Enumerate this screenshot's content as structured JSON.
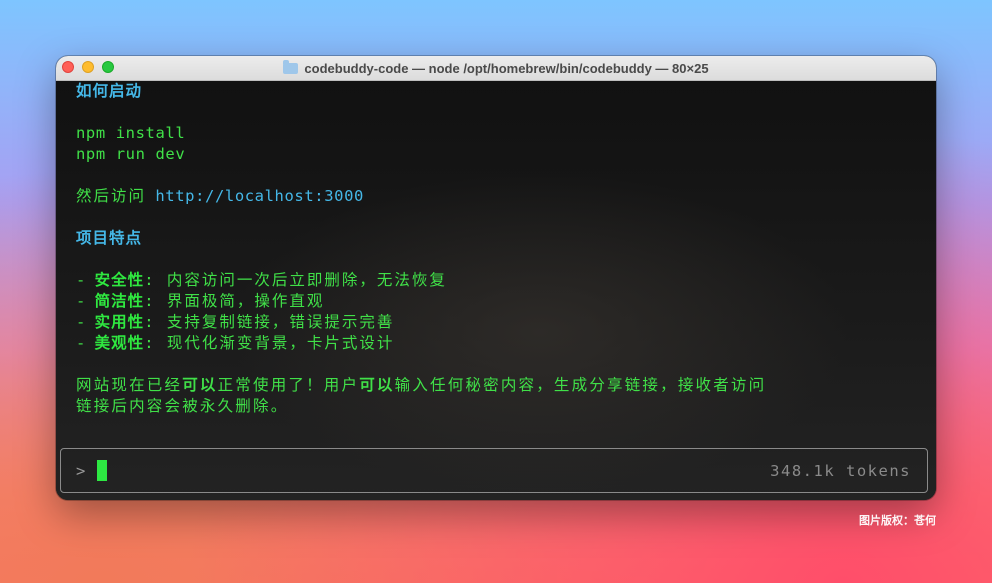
{
  "window": {
    "title": "codebuddy-code — node /opt/homebrew/bin/codebuddy — 80×25",
    "icon": "folder-icon"
  },
  "terminal": {
    "heading_start": "如何启动",
    "cmd_install": "npm install",
    "cmd_run": "npm run dev",
    "visit_prefix": "然后访问",
    "visit_url": "http://localhost:3000",
    "heading_features": "项目特点",
    "features": [
      {
        "dash": "- ",
        "label": "安全性",
        "text": ": 内容访问一次后立即删除，无法恢复"
      },
      {
        "dash": "- ",
        "label": "简洁性",
        "text": ": 界面极简，操作直观"
      },
      {
        "dash": "- ",
        "label": "实用性",
        "text": ": 支持复制链接，错误提示完善"
      },
      {
        "dash": "- ",
        "label": "美观性",
        "text": ": 现代化渐变背景，卡片式设计"
      }
    ],
    "summary_line1_a": "网站现在已经",
    "summary_line1_b": "可以",
    "summary_line1_c": "正常使用了！用户",
    "summary_line1_d": "可以",
    "summary_line1_e": "输入任何秘密内容，生成分享链接，接收者访问",
    "summary_line2": "链接后内容会被永久删除。"
  },
  "input": {
    "prompt": ">",
    "tokens": "348.1k tokens"
  },
  "watermark": "图片版权：苍何",
  "colors": {
    "green": "#40e048",
    "cyan": "#45b8e8",
    "cursor": "#2de842"
  }
}
